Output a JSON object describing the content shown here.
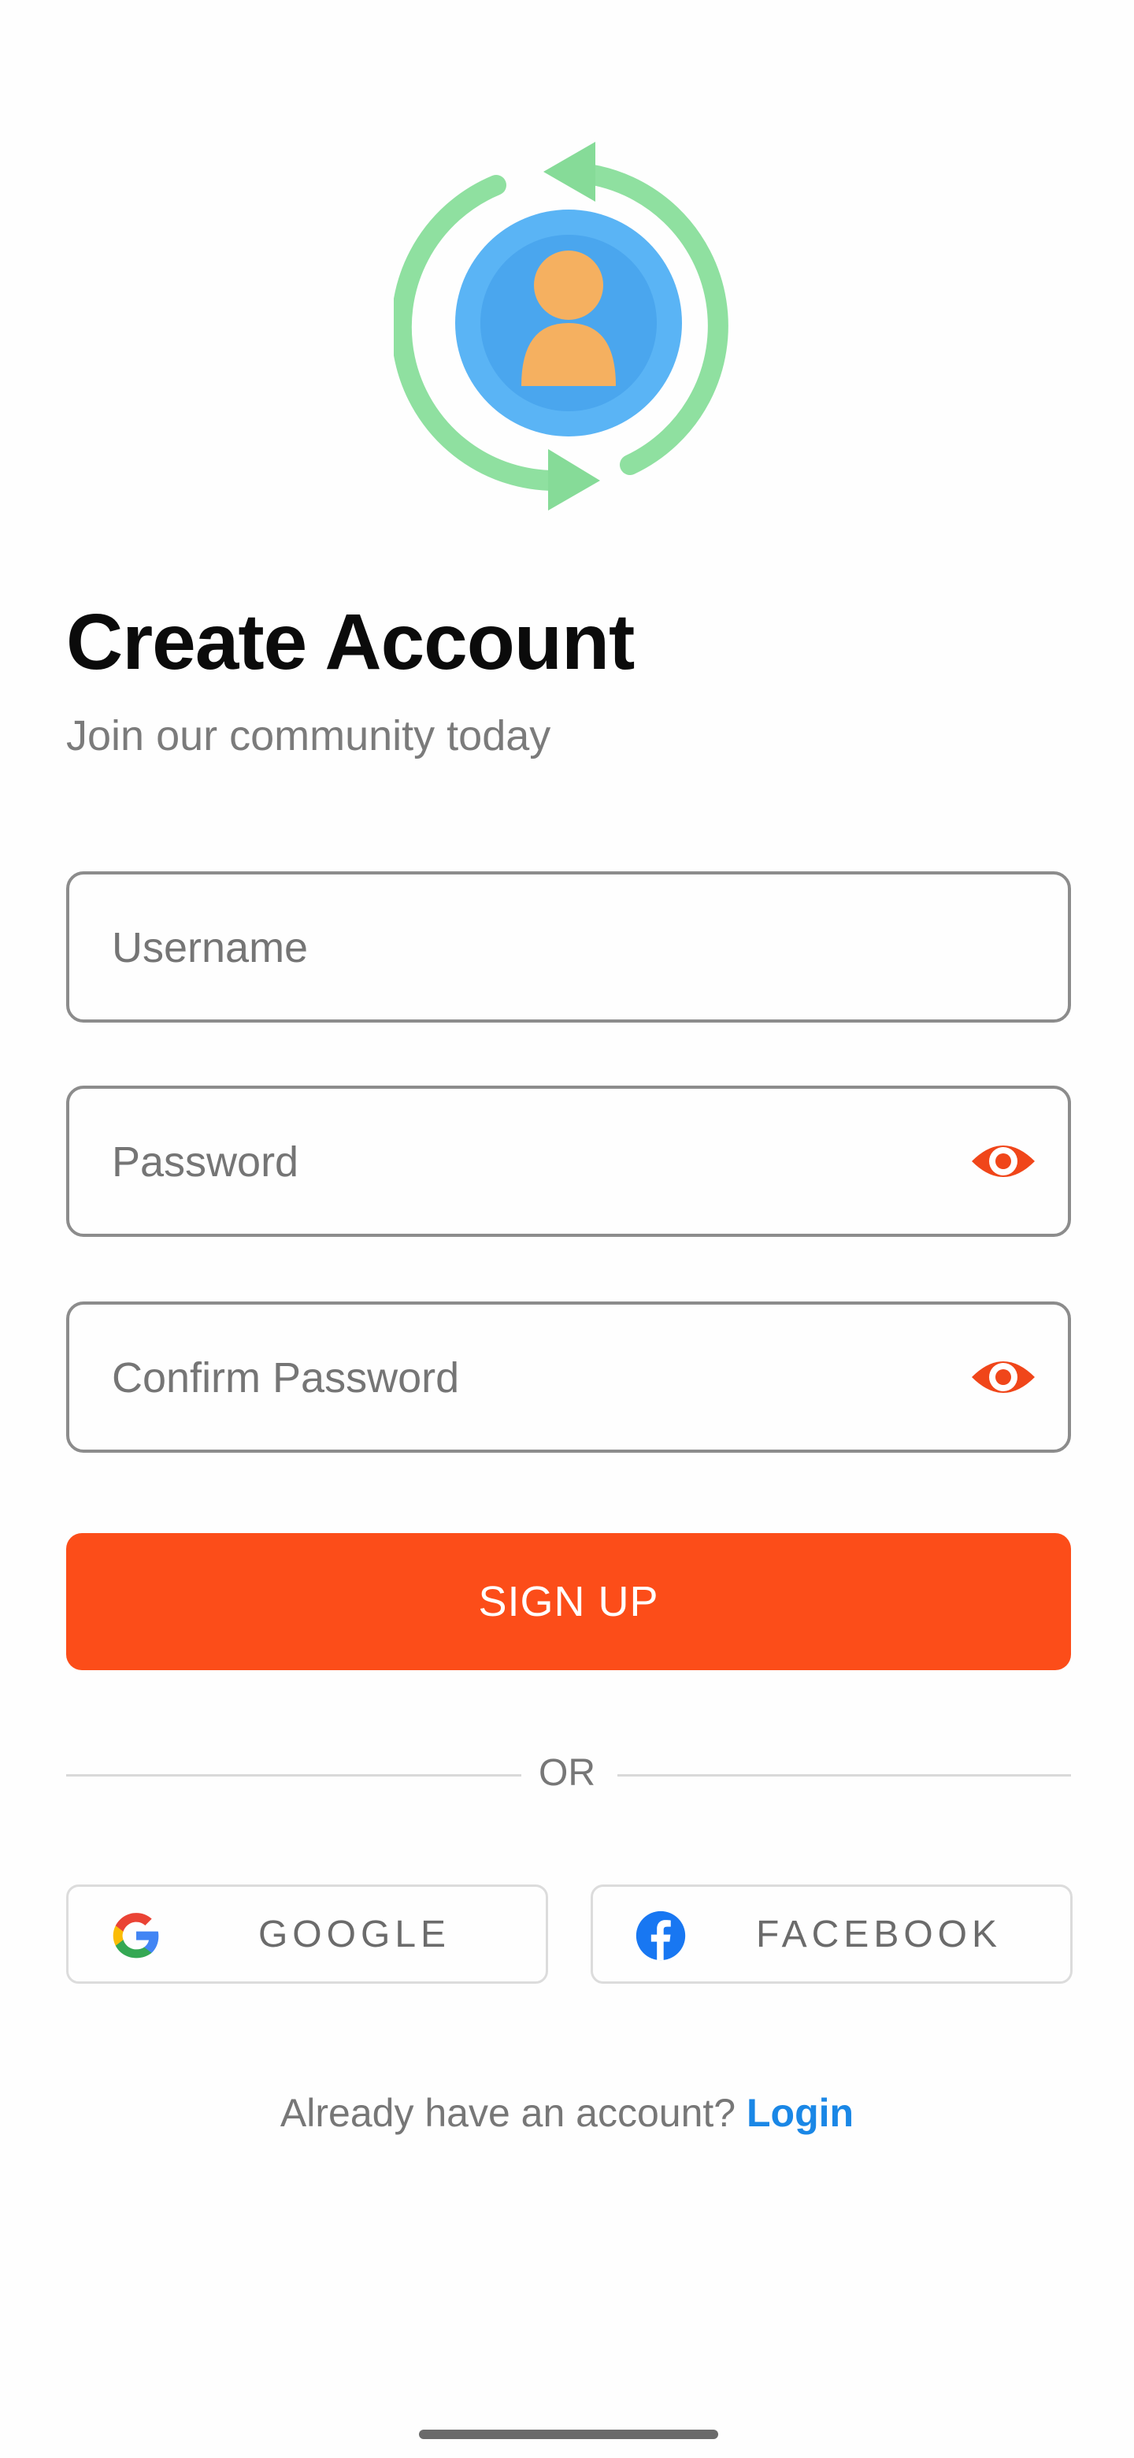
{
  "header": {
    "title": "Create Account",
    "subtitle": "Join our community today"
  },
  "form": {
    "username": {
      "placeholder": "Username",
      "value": ""
    },
    "password": {
      "placeholder": "Password",
      "value": ""
    },
    "confirm_password": {
      "placeholder": "Confirm Password",
      "value": ""
    }
  },
  "actions": {
    "signup_label": "SIGN UP",
    "divider_label": "OR"
  },
  "social": {
    "google_label": "GOOGLE",
    "facebook_label": "FACEBOOK"
  },
  "footer": {
    "prompt": "Already have an account?",
    "login_label": "Login"
  },
  "icons": {
    "hero": "account-sync-icon",
    "password_toggle": "eye-icon",
    "google": "google-icon",
    "facebook": "facebook-icon"
  },
  "colors": {
    "accent": "#fc4d19",
    "link": "#1a87e6",
    "hero_ring": "#8fe0a0",
    "hero_circle": "#5ab4f5",
    "hero_person": "#f5b060"
  }
}
